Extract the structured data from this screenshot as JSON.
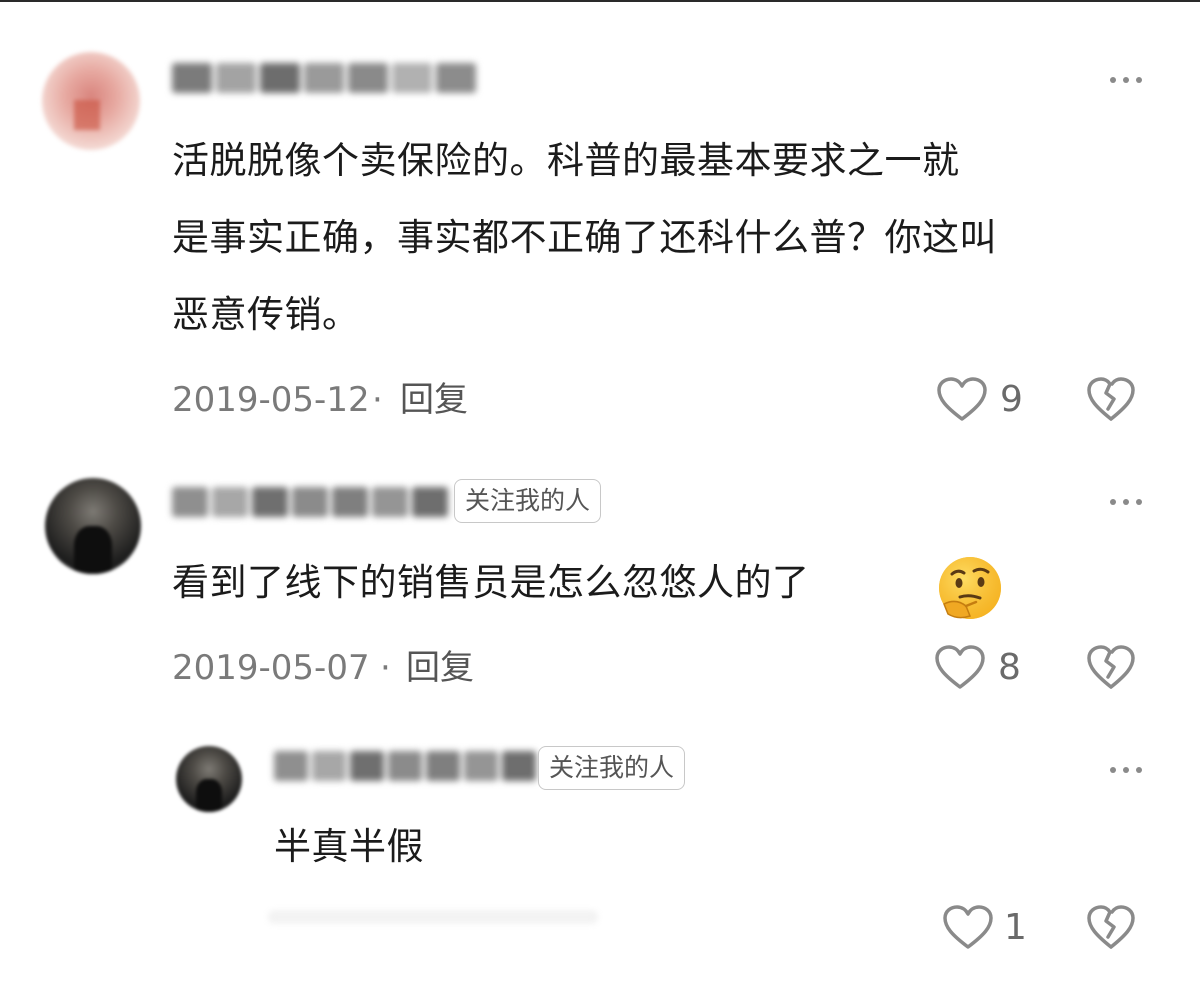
{
  "comments": [
    {
      "text_lines": [
        "活脱脱像个卖保险的。科普的最基本要求之一就",
        "是事实正确，事实都不正确了还科什么普？你这叫",
        "恶意传销。"
      ],
      "date": "2019-05-12",
      "separator": "·",
      "reply_label": "回复",
      "like_count": "9",
      "avatar_icon": "user-avatar",
      "more_icon": "more-horizontal-icon"
    },
    {
      "badge": "关注我的人",
      "text": "看到了线下的销售员是怎么忽悠人的了",
      "emoji": "thinking-face-emoji",
      "date": "2019-05-07",
      "separator": "·",
      "reply_label": "回复",
      "like_count": "8",
      "avatar_icon": "user-avatar",
      "more_icon": "more-horizontal-icon"
    },
    {
      "badge": "关注我的人",
      "text": "半真半假",
      "like_count": "1",
      "avatar_icon": "user-avatar",
      "more_icon": "more-horizontal-icon"
    }
  ],
  "icons": {
    "like": "heart-icon",
    "dislike": "broken-heart-icon"
  },
  "colors": {
    "text": "#1b1b1b",
    "meta": "#7a7a7a",
    "icon": "#8a8a8a",
    "badge_border": "#c8c8c8"
  }
}
